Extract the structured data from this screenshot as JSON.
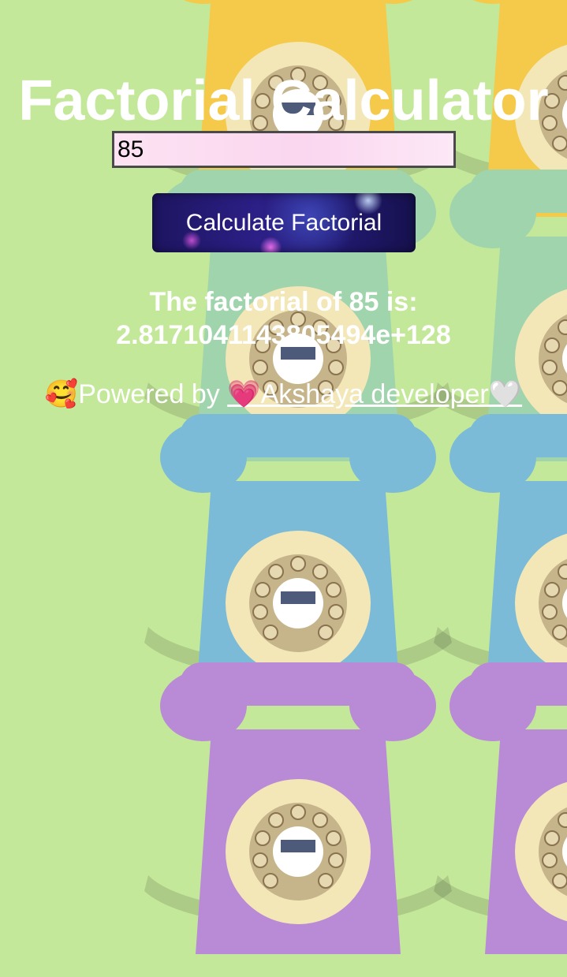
{
  "app": {
    "title": "Factorial Calculator"
  },
  "input": {
    "value": "85"
  },
  "button": {
    "label": "Calculate Factorial"
  },
  "result": {
    "line1": "The factorial of 85 is:",
    "line2": "2.8171041143805494e+128"
  },
  "footer": {
    "emoji": "🥰",
    "prefix": "Powered by ",
    "link_text": "💗Akshaya developer🤍"
  },
  "colors": {
    "background": "#c4e89a",
    "text": "#ffffff",
    "phones": [
      "#f5c94a",
      "#9fd4ad",
      "#7bbbd8",
      "#b98ad6"
    ]
  }
}
